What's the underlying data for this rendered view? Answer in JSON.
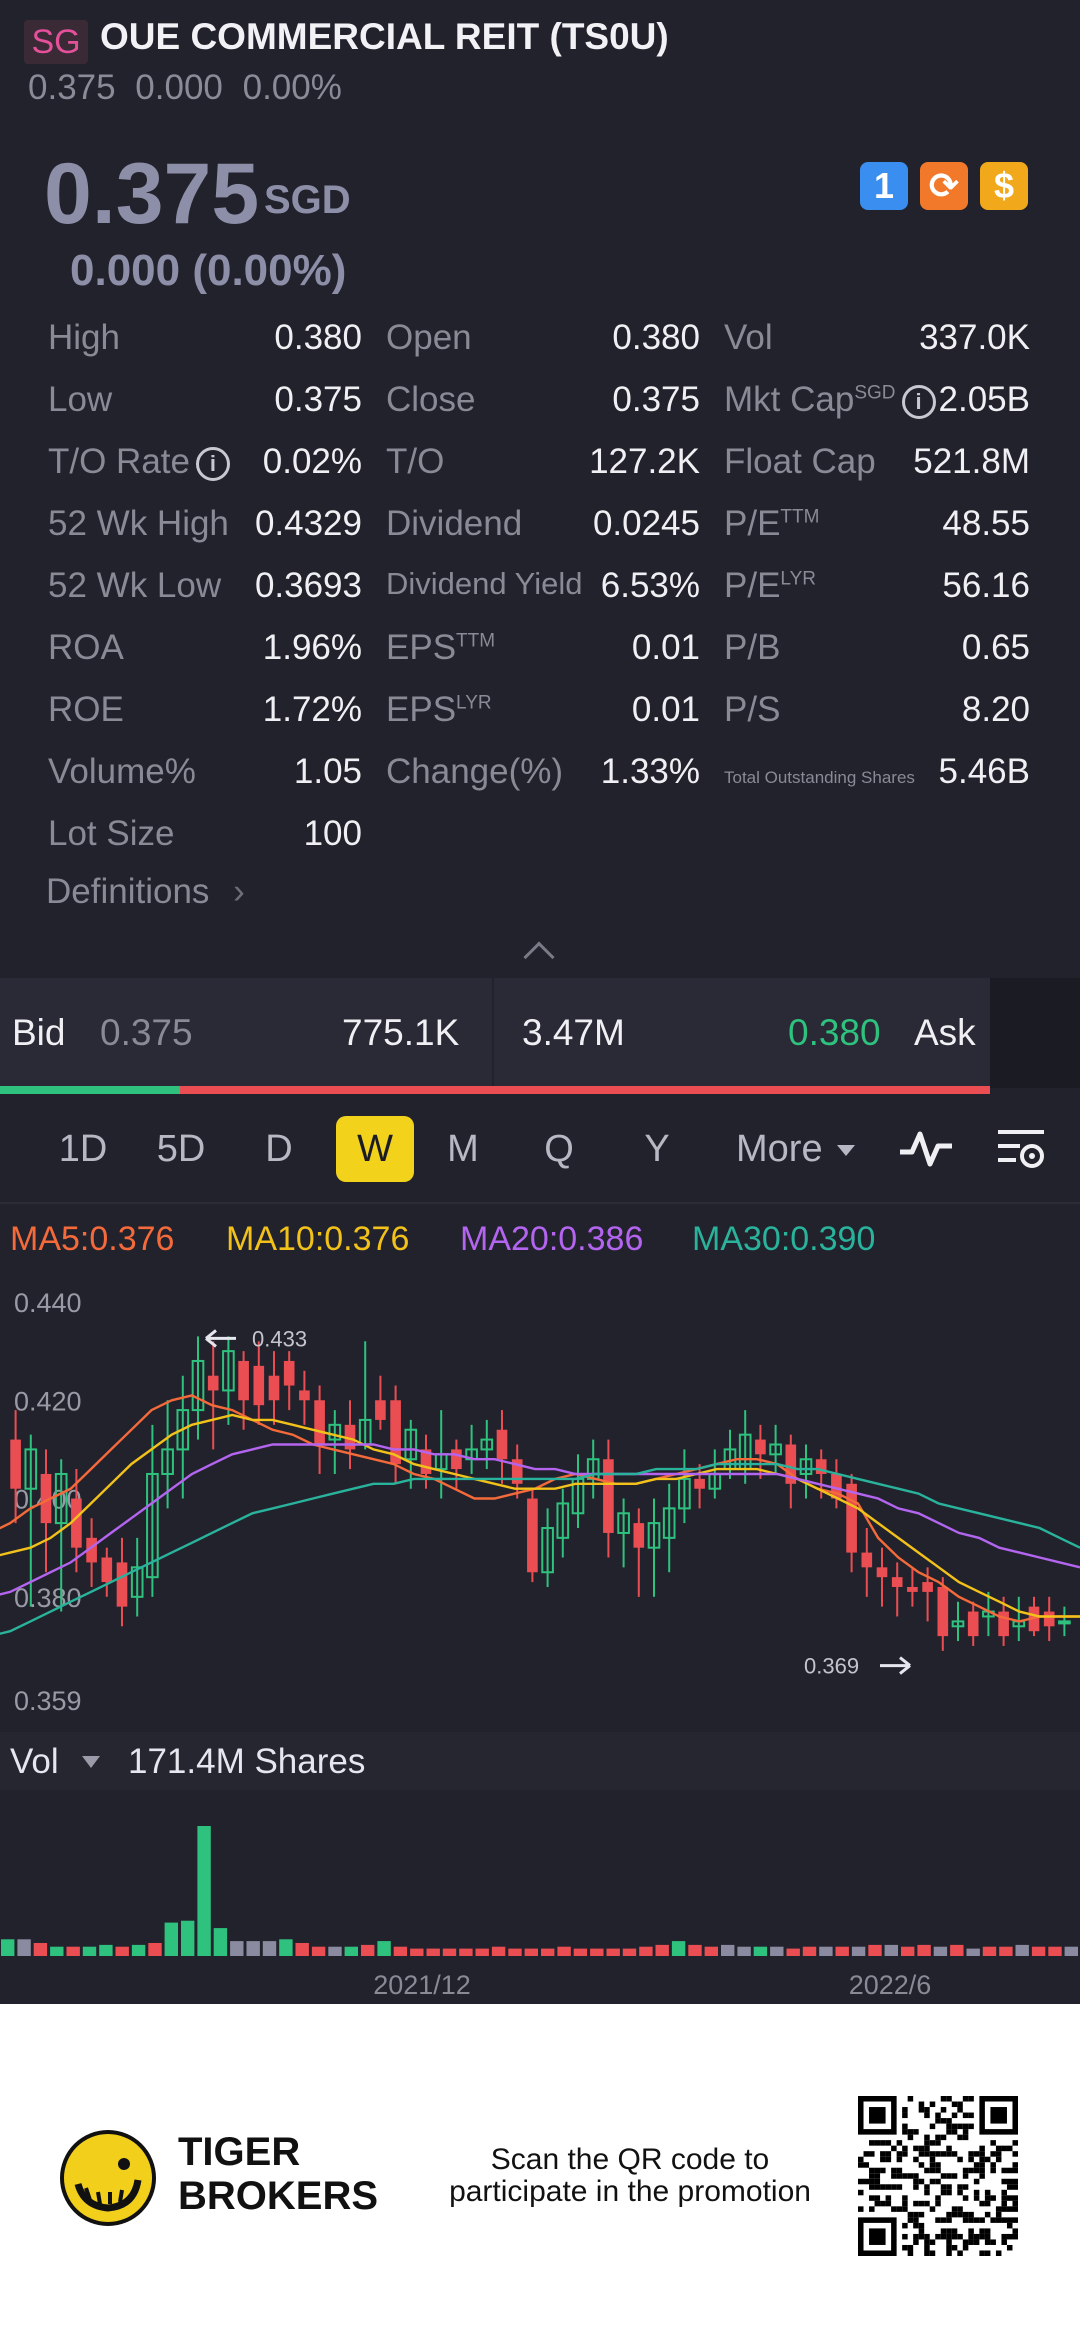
{
  "header": {
    "flag": "SG",
    "title": "OUE COMMERCIAL REIT (TS0U)",
    "summary": "0.375 0.000 0.00%"
  },
  "quote": {
    "price": "0.375",
    "currency": "SGD",
    "change": "0.000 (0.00%)"
  },
  "badges": [
    {
      "icon": "lightning-level1-icon",
      "text": "1",
      "color": "#3a8ef0"
    },
    {
      "icon": "sync-icon",
      "text": "⟳",
      "color": "#f2782a"
    },
    {
      "icon": "dollar-icon",
      "text": "$",
      "color": "#f2a81b"
    }
  ],
  "stats": [
    [
      {
        "label": "High",
        "value": "0.380"
      },
      {
        "label": "Open",
        "value": "0.380"
      },
      {
        "label": "Vol",
        "value": "337.0K"
      }
    ],
    [
      {
        "label": "Low",
        "value": "0.375"
      },
      {
        "label": "Close",
        "value": "0.375"
      },
      {
        "label": "Mkt Cap",
        "sup": "SGD",
        "info": true,
        "value": "2.05B"
      }
    ],
    [
      {
        "label": "T/O Rate",
        "info": true,
        "value": "0.02%"
      },
      {
        "label": "T/O",
        "value": "127.2K"
      },
      {
        "label": "Float Cap",
        "value": "521.8M"
      }
    ],
    [
      {
        "label": "52 Wk High",
        "value": "0.4329"
      },
      {
        "label": "Dividend",
        "value": "0.0245"
      },
      {
        "label": "P/E",
        "sup": "TTM",
        "value": "48.55"
      }
    ],
    [
      {
        "label": "52 Wk Low",
        "value": "0.3693"
      },
      {
        "label": "Dividend Yield",
        "small": true,
        "value": "6.53%"
      },
      {
        "label": "P/E",
        "sup": "LYR",
        "value": "56.16"
      }
    ],
    [
      {
        "label": "ROA",
        "value": "1.96%"
      },
      {
        "label": "EPS",
        "sup": "TTM",
        "value": "0.01"
      },
      {
        "label": "P/B",
        "value": "0.65"
      }
    ],
    [
      {
        "label": "ROE",
        "value": "1.72%"
      },
      {
        "label": "EPS",
        "sup": "LYR",
        "value": "0.01"
      },
      {
        "label": "P/S",
        "value": "8.20"
      }
    ],
    [
      {
        "label": "Volume%",
        "value": "1.05"
      },
      {
        "label": "Change(%)",
        "value": "1.33%"
      },
      {
        "label": "Total Outstanding Shares",
        "tiny": true,
        "value": "5.46B"
      }
    ],
    [
      {
        "label": "Lot Size",
        "value": "100"
      }
    ]
  ],
  "definitions": "Definitions",
  "bidask": {
    "bid_label": "Bid",
    "bid_price": "0.375",
    "bid_vol": "775.1K",
    "ask_vol": "3.47M",
    "ask_price": "0.380",
    "ask_label": "Ask",
    "bid_ratio": 0.182
  },
  "periods": [
    "1D",
    "5D",
    "D",
    "W",
    "M",
    "Q",
    "Y"
  ],
  "active_period": "W",
  "more": "More",
  "ma": [
    {
      "label": "MA5:0.376",
      "color": "#f46a3a"
    },
    {
      "label": "MA10:0.376",
      "color": "#f2c21b"
    },
    {
      "label": "MA20:0.386",
      "color": "#b465f0"
    },
    {
      "label": "MA30:0.390",
      "color": "#2ab39c"
    }
  ],
  "chart_data": {
    "type": "candlestick",
    "y_ticks": [
      "0.440",
      "0.420",
      "0.400",
      "0.380",
      "0.359"
    ],
    "ylim": [
      0.359,
      0.44
    ],
    "max_label": "0.433",
    "min_label": "0.369",
    "x_ticks": [
      "2021/12",
      "2022/6"
    ],
    "candles": [
      {
        "o": 0.412,
        "c": 0.402,
        "h": 0.418,
        "l": 0.395
      },
      {
        "o": 0.402,
        "c": 0.41,
        "h": 0.413,
        "l": 0.378
      },
      {
        "o": 0.405,
        "c": 0.395,
        "h": 0.41,
        "l": 0.385
      },
      {
        "o": 0.395,
        "c": 0.405,
        "h": 0.408,
        "l": 0.377
      },
      {
        "o": 0.4,
        "c": 0.39,
        "h": 0.406,
        "l": 0.385
      },
      {
        "o": 0.392,
        "c": 0.387,
        "h": 0.396,
        "l": 0.382
      },
      {
        "o": 0.388,
        "c": 0.383,
        "h": 0.39,
        "l": 0.38
      },
      {
        "o": 0.387,
        "c": 0.378,
        "h": 0.392,
        "l": 0.374
      },
      {
        "o": 0.38,
        "c": 0.386,
        "h": 0.392,
        "l": 0.376
      },
      {
        "o": 0.384,
        "c": 0.405,
        "h": 0.415,
        "l": 0.38
      },
      {
        "o": 0.405,
        "c": 0.41,
        "h": 0.42,
        "l": 0.398
      },
      {
        "o": 0.41,
        "c": 0.418,
        "h": 0.425,
        "l": 0.4
      },
      {
        "o": 0.418,
        "c": 0.428,
        "h": 0.433,
        "l": 0.412
      },
      {
        "o": 0.425,
        "c": 0.422,
        "h": 0.432,
        "l": 0.41
      },
      {
        "o": 0.422,
        "c": 0.43,
        "h": 0.433,
        "l": 0.415
      },
      {
        "o": 0.428,
        "c": 0.42,
        "h": 0.43,
        "l": 0.414
      },
      {
        "o": 0.427,
        "c": 0.419,
        "h": 0.432,
        "l": 0.415
      },
      {
        "o": 0.425,
        "c": 0.42,
        "h": 0.43,
        "l": 0.415
      },
      {
        "o": 0.428,
        "c": 0.423,
        "h": 0.43,
        "l": 0.418
      },
      {
        "o": 0.422,
        "c": 0.42,
        "h": 0.426,
        "l": 0.415
      },
      {
        "o": 0.42,
        "c": 0.411,
        "h": 0.423,
        "l": 0.405
      },
      {
        "o": 0.412,
        "c": 0.415,
        "h": 0.418,
        "l": 0.405
      },
      {
        "o": 0.415,
        "c": 0.41,
        "h": 0.42,
        "l": 0.406
      },
      {
        "o": 0.411,
        "c": 0.416,
        "h": 0.432,
        "l": 0.41
      },
      {
        "o": 0.42,
        "c": 0.416,
        "h": 0.425,
        "l": 0.414
      },
      {
        "o": 0.42,
        "c": 0.407,
        "h": 0.423,
        "l": 0.403
      },
      {
        "o": 0.408,
        "c": 0.414,
        "h": 0.416,
        "l": 0.402
      },
      {
        "o": 0.41,
        "c": 0.405,
        "h": 0.413,
        "l": 0.402
      },
      {
        "o": 0.406,
        "c": 0.409,
        "h": 0.418,
        "l": 0.4
      },
      {
        "o": 0.41,
        "c": 0.406,
        "h": 0.412,
        "l": 0.402
      },
      {
        "o": 0.408,
        "c": 0.41,
        "h": 0.415,
        "l": 0.405
      },
      {
        "o": 0.41,
        "c": 0.412,
        "h": 0.416,
        "l": 0.406
      },
      {
        "o": 0.414,
        "c": 0.408,
        "h": 0.418,
        "l": 0.403
      },
      {
        "o": 0.408,
        "c": 0.403,
        "h": 0.411,
        "l": 0.4
      },
      {
        "o": 0.4,
        "c": 0.385,
        "h": 0.402,
        "l": 0.383
      },
      {
        "o": 0.385,
        "c": 0.394,
        "h": 0.398,
        "l": 0.382
      },
      {
        "o": 0.392,
        "c": 0.399,
        "h": 0.402,
        "l": 0.388
      },
      {
        "o": 0.397,
        "c": 0.404,
        "h": 0.409,
        "l": 0.394
      },
      {
        "o": 0.404,
        "c": 0.408,
        "h": 0.412,
        "l": 0.4
      },
      {
        "o": 0.408,
        "c": 0.393,
        "h": 0.412,
        "l": 0.388
      },
      {
        "o": 0.393,
        "c": 0.397,
        "h": 0.4,
        "l": 0.386
      },
      {
        "o": 0.395,
        "c": 0.39,
        "h": 0.398,
        "l": 0.38
      },
      {
        "o": 0.39,
        "c": 0.395,
        "h": 0.4,
        "l": 0.38
      },
      {
        "o": 0.392,
        "c": 0.398,
        "h": 0.403,
        "l": 0.385
      },
      {
        "o": 0.398,
        "c": 0.404,
        "h": 0.41,
        "l": 0.395
      },
      {
        "o": 0.404,
        "c": 0.402,
        "h": 0.407,
        "l": 0.398
      },
      {
        "o": 0.402,
        "c": 0.405,
        "h": 0.41,
        "l": 0.4
      },
      {
        "o": 0.406,
        "c": 0.41,
        "h": 0.414,
        "l": 0.404
      },
      {
        "o": 0.406,
        "c": 0.413,
        "h": 0.418,
        "l": 0.403
      },
      {
        "o": 0.412,
        "c": 0.409,
        "h": 0.415,
        "l": 0.404
      },
      {
        "o": 0.409,
        "c": 0.411,
        "h": 0.415,
        "l": 0.405
      },
      {
        "o": 0.411,
        "c": 0.403,
        "h": 0.413,
        "l": 0.398
      },
      {
        "o": 0.405,
        "c": 0.408,
        "h": 0.411,
        "l": 0.4
      },
      {
        "o": 0.408,
        "c": 0.405,
        "h": 0.41,
        "l": 0.4
      },
      {
        "o": 0.405,
        "c": 0.4,
        "h": 0.408,
        "l": 0.398
      },
      {
        "o": 0.403,
        "c": 0.389,
        "h": 0.405,
        "l": 0.385
      },
      {
        "o": 0.389,
        "c": 0.386,
        "h": 0.394,
        "l": 0.38
      },
      {
        "o": 0.386,
        "c": 0.384,
        "h": 0.39,
        "l": 0.378
      },
      {
        "o": 0.384,
        "c": 0.382,
        "h": 0.387,
        "l": 0.376
      },
      {
        "o": 0.382,
        "c": 0.381,
        "h": 0.386,
        "l": 0.378
      },
      {
        "o": 0.383,
        "c": 0.381,
        "h": 0.386,
        "l": 0.375
      },
      {
        "o": 0.382,
        "c": 0.372,
        "h": 0.384,
        "l": 0.369
      },
      {
        "o": 0.374,
        "c": 0.375,
        "h": 0.379,
        "l": 0.371
      },
      {
        "o": 0.377,
        "c": 0.372,
        "h": 0.379,
        "l": 0.37
      },
      {
        "o": 0.376,
        "c": 0.377,
        "h": 0.381,
        "l": 0.372
      },
      {
        "o": 0.377,
        "c": 0.372,
        "h": 0.38,
        "l": 0.37
      },
      {
        "o": 0.374,
        "c": 0.375,
        "h": 0.38,
        "l": 0.371
      },
      {
        "o": 0.378,
        "c": 0.373,
        "h": 0.38,
        "l": 0.372
      },
      {
        "o": 0.377,
        "c": 0.374,
        "h": 0.38,
        "l": 0.371
      },
      {
        "o": 0.375,
        "c": 0.375,
        "h": 0.378,
        "l": 0.372
      }
    ],
    "ma_series": [
      {
        "name": "MA5",
        "values": [
          0.393,
          0.395,
          0.398,
          0.4,
          0.402,
          0.406,
          0.41,
          0.414,
          0.418,
          0.42,
          0.421,
          0.419,
          0.418,
          0.416,
          0.414,
          0.413,
          0.411,
          0.41,
          0.409,
          0.408,
          0.407,
          0.405,
          0.404,
          0.402,
          0.4,
          0.4,
          0.401,
          0.402,
          0.404,
          0.405,
          0.404,
          0.403,
          0.403,
          0.404,
          0.405,
          0.406,
          0.407,
          0.408,
          0.408,
          0.407,
          0.404,
          0.402,
          0.401,
          0.399,
          0.392,
          0.388,
          0.385,
          0.383,
          0.38,
          0.378,
          0.376,
          0.375,
          0.376,
          0.376,
          0.376
        ]
      },
      {
        "name": "MA10",
        "values": [
          0.388,
          0.389,
          0.39,
          0.392,
          0.395,
          0.399,
          0.403,
          0.407,
          0.41,
          0.413,
          0.415,
          0.416,
          0.417,
          0.416,
          0.416,
          0.415,
          0.414,
          0.413,
          0.412,
          0.41,
          0.409,
          0.407,
          0.406,
          0.405,
          0.404,
          0.403,
          0.402,
          0.402,
          0.402,
          0.403,
          0.403,
          0.403,
          0.403,
          0.404,
          0.404,
          0.405,
          0.406,
          0.406,
          0.406,
          0.405,
          0.404,
          0.402,
          0.4,
          0.398,
          0.395,
          0.392,
          0.389,
          0.386,
          0.383,
          0.381,
          0.379,
          0.377,
          0.376,
          0.376,
          0.376
        ]
      },
      {
        "name": "MA20",
        "values": [
          0.38,
          0.381,
          0.383,
          0.385,
          0.387,
          0.39,
          0.393,
          0.396,
          0.399,
          0.402,
          0.405,
          0.407,
          0.409,
          0.41,
          0.411,
          0.411,
          0.411,
          0.411,
          0.411,
          0.411,
          0.41,
          0.41,
          0.409,
          0.409,
          0.408,
          0.408,
          0.407,
          0.406,
          0.406,
          0.405,
          0.405,
          0.405,
          0.405,
          0.405,
          0.405,
          0.405,
          0.405,
          0.405,
          0.405,
          0.405,
          0.404,
          0.403,
          0.402,
          0.401,
          0.4,
          0.398,
          0.397,
          0.395,
          0.393,
          0.392,
          0.39,
          0.389,
          0.388,
          0.387,
          0.386
        ]
      },
      {
        "name": "MA30",
        "values": [
          0.372,
          0.373,
          0.375,
          0.377,
          0.379,
          0.381,
          0.383,
          0.385,
          0.387,
          0.389,
          0.391,
          0.393,
          0.395,
          0.397,
          0.398,
          0.399,
          0.4,
          0.401,
          0.402,
          0.403,
          0.403,
          0.404,
          0.404,
          0.404,
          0.404,
          0.404,
          0.404,
          0.404,
          0.404,
          0.404,
          0.405,
          0.405,
          0.405,
          0.406,
          0.406,
          0.406,
          0.407,
          0.407,
          0.407,
          0.407,
          0.406,
          0.406,
          0.405,
          0.404,
          0.403,
          0.402,
          0.401,
          0.399,
          0.398,
          0.397,
          0.396,
          0.395,
          0.394,
          0.392,
          0.39
        ]
      }
    ],
    "volume": {
      "label": "Vol",
      "value": "171.4M Shares",
      "bars": [
        9,
        9,
        7,
        5,
        5,
        5,
        6,
        5,
        6,
        7,
        18,
        19,
        70,
        15,
        8,
        8,
        8,
        9,
        7,
        5,
        5,
        5,
        6,
        8,
        5,
        4,
        4,
        4,
        4,
        4,
        5,
        4,
        4,
        4,
        5,
        4,
        4,
        4,
        4,
        5,
        6,
        8,
        6,
        5,
        6,
        5,
        5,
        5,
        4,
        5,
        5,
        5,
        5,
        6,
        6,
        5,
        6,
        5,
        6,
        4,
        5,
        5,
        6,
        5,
        5,
        5
      ],
      "colors": [
        "g",
        "p",
        "r",
        "g",
        "r",
        "g",
        "g",
        "r",
        "g",
        "r",
        "g",
        "g",
        "g",
        "g",
        "p",
        "p",
        "p",
        "g",
        "r",
        "r",
        "p",
        "g",
        "r",
        "g",
        "r",
        "r",
        "r",
        "r",
        "r",
        "r",
        "r",
        "r",
        "r",
        "r",
        "r",
        "r",
        "r",
        "r",
        "r",
        "r",
        "r",
        "g",
        "r",
        "r",
        "p",
        "p",
        "g",
        "p",
        "r",
        "r",
        "p",
        "r",
        "p",
        "r",
        "p",
        "r",
        "r",
        "p",
        "r",
        "p",
        "r",
        "r",
        "p",
        "r",
        "r",
        "p"
      ]
    }
  },
  "footer": {
    "brand_line1": "TIGER",
    "brand_line2": "BROKERS",
    "promo": "Scan the QR code to participate in the promotion"
  }
}
